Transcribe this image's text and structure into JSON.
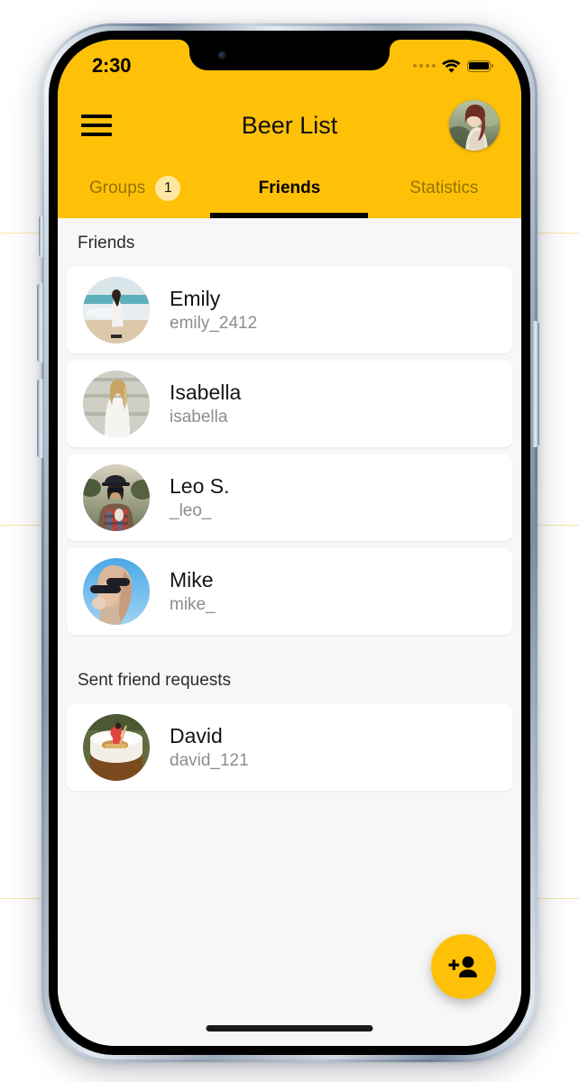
{
  "status_bar": {
    "time": "2:30",
    "signal_icon": "cellular-dots-icon",
    "wifi_icon": "wifi-icon",
    "battery_icon": "battery-full-icon"
  },
  "app_bar": {
    "menu_icon": "hamburger-menu-icon",
    "title": "Beer List",
    "avatar_icon": "user-avatar"
  },
  "tabs": [
    {
      "label": "Groups",
      "badge": "1",
      "active": false
    },
    {
      "label": "Friends",
      "badge": "",
      "active": true
    },
    {
      "label": "Statistics",
      "badge": "",
      "active": false
    }
  ],
  "sections": [
    {
      "header": "Friends",
      "items": [
        {
          "name": "Emily",
          "handle": "emily_2412"
        },
        {
          "name": "Isabella",
          "handle": "isabella"
        },
        {
          "name": "Leo S.",
          "handle": "_leo_"
        },
        {
          "name": "Mike",
          "handle": "mike_"
        }
      ]
    },
    {
      "header": "Sent friend requests",
      "items": [
        {
          "name": "David",
          "handle": "david_121"
        }
      ]
    }
  ],
  "fab": {
    "icon": "add-person-icon",
    "label": "Add friend"
  },
  "colors": {
    "accent": "#FFC107",
    "badge_bg": "#FFE8A3",
    "content_bg": "#F7F7F7",
    "card_bg": "#FFFFFF",
    "primary_text": "#151515",
    "secondary_text": "#8D8D8D"
  }
}
